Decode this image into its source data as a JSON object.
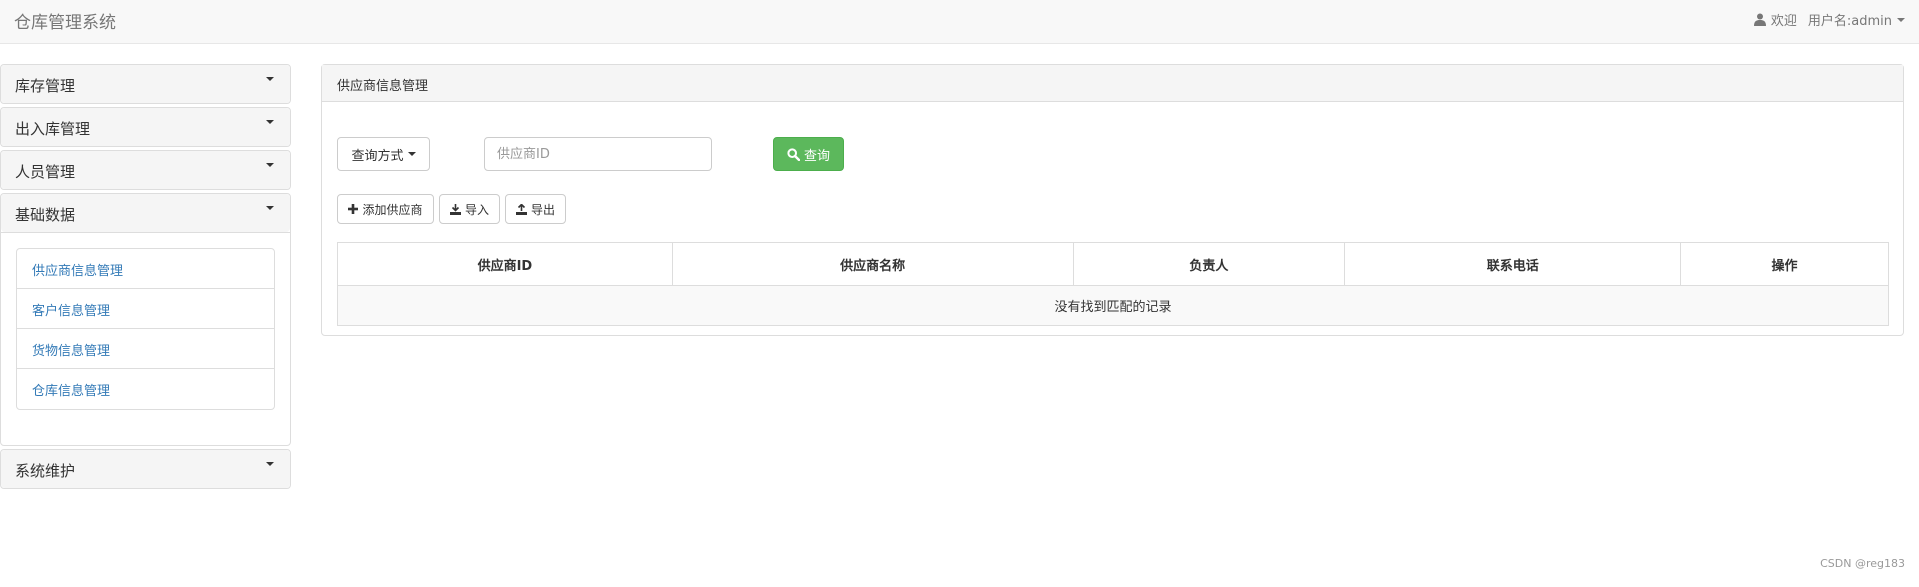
{
  "app": {
    "title": "仓库管理系统"
  },
  "user": {
    "welcome": "欢迎",
    "username": "用户名:admin"
  },
  "sidebar": {
    "sections": [
      {
        "label": "库存管理"
      },
      {
        "label": "出入库管理"
      },
      {
        "label": "人员管理"
      },
      {
        "label": "基础数据",
        "items": [
          "供应商信息管理",
          "客户信息管理",
          "货物信息管理",
          "仓库信息管理"
        ]
      },
      {
        "label": "系统维护"
      }
    ]
  },
  "main": {
    "title": "供应商信息管理",
    "query_mode_label": "查询方式",
    "search_placeholder": "供应商ID",
    "query_label": "查询",
    "actions": {
      "add": "添加供应商",
      "import": "导入",
      "export": "导出"
    },
    "table": {
      "headers": [
        "供应商ID",
        "供应商名称",
        "负责人",
        "联系电话",
        "操作"
      ],
      "empty_text": "没有找到匹配的记录"
    }
  },
  "watermark": "CSDN @reg183",
  "colors": {
    "link": "#337ab7",
    "success": "#5cb85c"
  }
}
